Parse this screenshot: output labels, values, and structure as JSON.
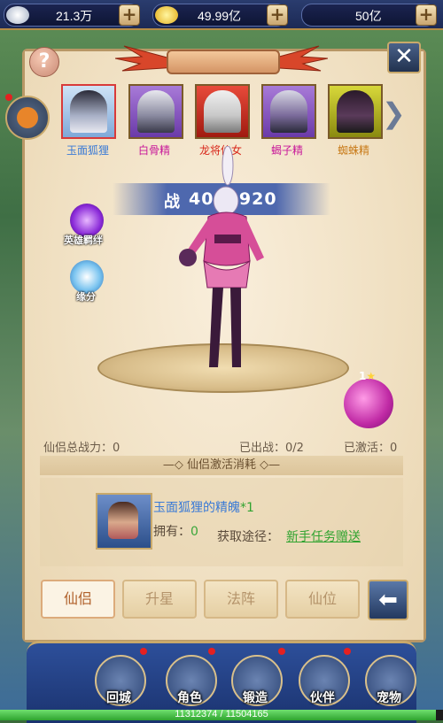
{
  "resources": {
    "silver": "21.3万",
    "gold": "49.99亿",
    "third": "50亿"
  },
  "hero_tabs": [
    {
      "name": "玉面狐狸",
      "color": "#3a7ad6",
      "selected": true
    },
    {
      "name": "白骨精",
      "color": "#c8189a",
      "selected": false
    },
    {
      "name": "龙将仙女",
      "color": "#d8261a",
      "selected": false
    },
    {
      "name": "蝎子精",
      "color": "#c8189a",
      "selected": false
    },
    {
      "name": "蜘蛛精",
      "color": "#c87a18",
      "selected": false
    }
  ],
  "power": {
    "label": "战",
    "value": "4011920"
  },
  "side": {
    "bond": "英雄羁绊",
    "fate": "缘分"
  },
  "star_level": "1",
  "stats": {
    "total_power": "仙侣总战力：0",
    "deployed": "已出战：0/2",
    "activated": "已激活：0"
  },
  "cost": {
    "title": "仙侣激活消耗",
    "item_name": "玉面狐狸的精魄",
    "item_qty": "*1",
    "own_label": "拥有：",
    "own_value": "0",
    "source_label": "获取途径：",
    "source_link": "新手任务赠送"
  },
  "tabs": [
    "仙侣",
    "升星",
    "法阵",
    "仙位"
  ],
  "active_tab": 0,
  "nav": [
    "回城",
    "角色",
    "锻造",
    "伙伴",
    "宠物"
  ],
  "hp": {
    "text": "11312374 / 11504165",
    "current": 11312374,
    "max": 11504165
  }
}
